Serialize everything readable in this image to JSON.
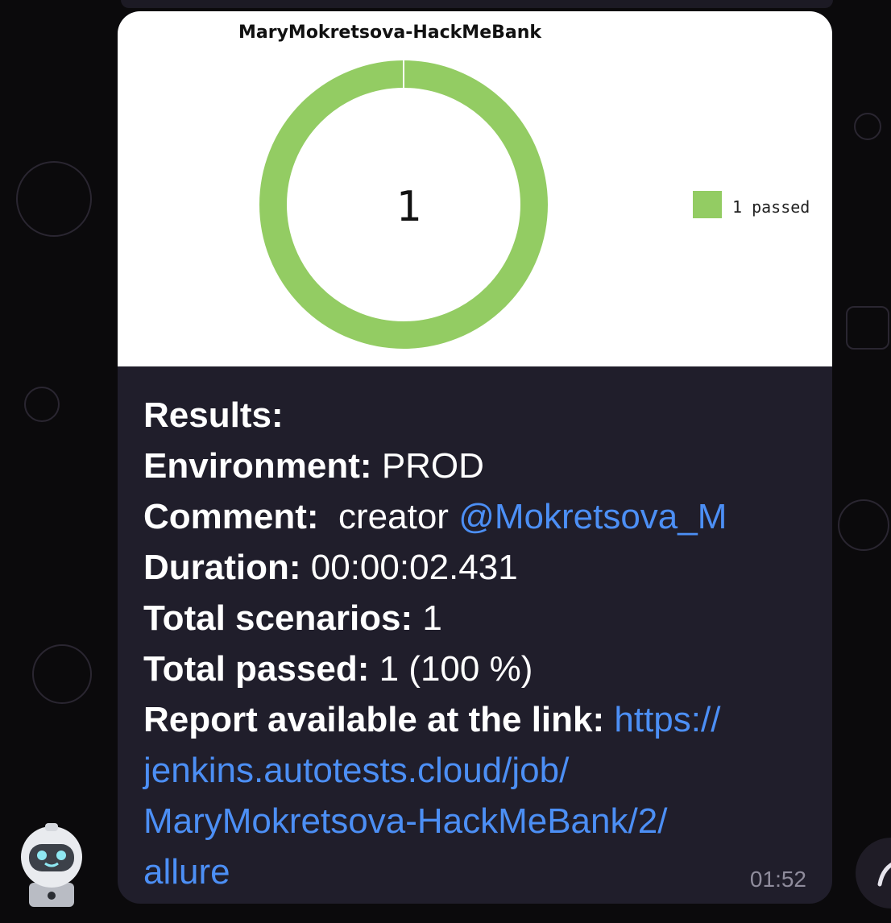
{
  "chart": {
    "title": "MaryMokretsova-HackMeBank",
    "center_value": "1",
    "legend_label": "1 passed",
    "passed_color": "#93cc63"
  },
  "chart_data": {
    "type": "pie",
    "title": "MaryMokretsova-HackMeBank",
    "categories": [
      "passed"
    ],
    "values": [
      1
    ],
    "legend": [
      "1 passed"
    ],
    "legend_position": "right"
  },
  "message": {
    "results_label": "Results:",
    "environment_label": "Environment:",
    "environment_value": "PROD",
    "comment_label": "Comment:",
    "comment_text": "creator",
    "comment_mention": "@Mokretsova_M",
    "duration_label": "Duration:",
    "duration_value": "00:00:02.431",
    "scenarios_label": "Total scenarios:",
    "scenarios_value": "1",
    "passed_label": "Total passed:",
    "passed_value": "1 (100 %)",
    "report_label": "Report available at the link:",
    "report_link_part1": "https://",
    "report_link_part2": "jenkins.autotests.cloud/job/",
    "report_link_part3": "MaryMokretsova-HackMeBank/2/",
    "report_link_part4": "allure",
    "time": "01:52"
  },
  "icons": {
    "avatar": "robot-avatar-icon",
    "scroll": "scroll-down-icon"
  }
}
